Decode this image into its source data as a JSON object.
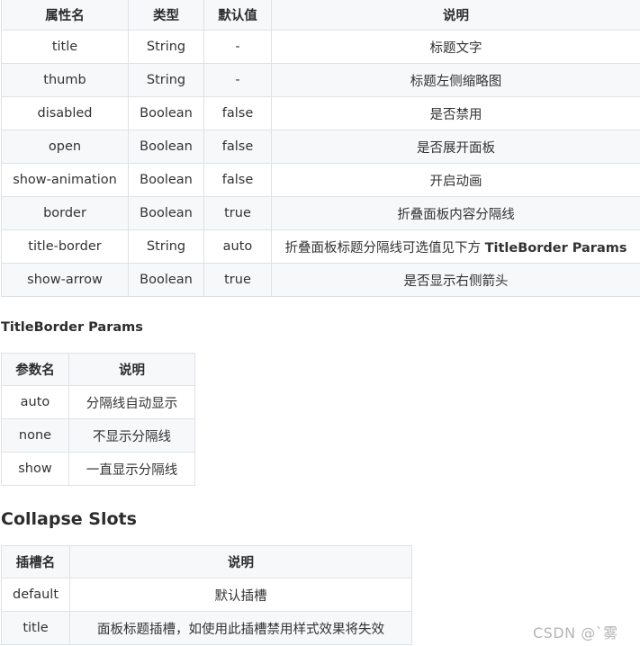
{
  "props_table": {
    "headers": [
      "属性名",
      "类型",
      "默认值",
      "说明"
    ],
    "rows": [
      {
        "name": "title",
        "type": "String",
        "default": "-",
        "desc": "标题文字"
      },
      {
        "name": "thumb",
        "type": "String",
        "default": "-",
        "desc": "标题左侧缩略图"
      },
      {
        "name": "disabled",
        "type": "Boolean",
        "default": "false",
        "desc": "是否禁用"
      },
      {
        "name": "open",
        "type": "Boolean",
        "default": "false",
        "desc": "是否展开面板"
      },
      {
        "name": "show-animation",
        "type": "Boolean",
        "default": "false",
        "desc": "开启动画"
      },
      {
        "name": "border",
        "type": "Boolean",
        "default": "true",
        "desc": "折叠面板内容分隔线"
      },
      {
        "name": "title-border",
        "type": "String",
        "default": "auto",
        "desc": "折叠面板标题分隔线可选值见下方",
        "desc_strong": "TitleBorder Params"
      },
      {
        "name": "show-arrow",
        "type": "Boolean",
        "default": "true",
        "desc": "是否显示右侧箭头"
      }
    ]
  },
  "titleborder": {
    "heading": "TitleBorder Params",
    "headers": [
      "参数名",
      "说明"
    ],
    "rows": [
      {
        "name": "auto",
        "desc": "分隔线自动显示"
      },
      {
        "name": "none",
        "desc": "不显示分隔线"
      },
      {
        "name": "show",
        "desc": "一直显示分隔线"
      }
    ]
  },
  "slots": {
    "heading": "Collapse Slots",
    "headers": [
      "插槽名",
      "说明"
    ],
    "rows": [
      {
        "name": "default",
        "desc": "默认插槽"
      },
      {
        "name": "title",
        "desc": "面板标题插槽，如使用此插槽禁用样式效果将失效"
      }
    ]
  },
  "watermark": "CSDN @`雾"
}
